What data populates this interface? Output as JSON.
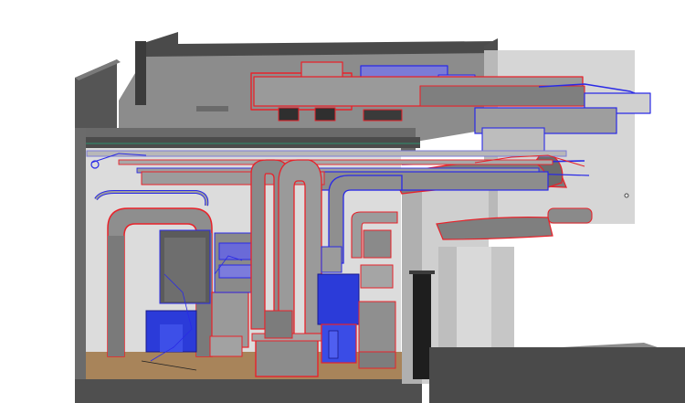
{
  "scene": {
    "subject": "building-section-mep-model",
    "colors": {
      "background": "#ffffff",
      "structure_light": "#d4d4d4",
      "structure_mid": "#a9a9a9",
      "structure_dark": "#5f5f5f",
      "structure_darker": "#3f3f3f",
      "duct_fill": "#8e8e8e",
      "duct_light": "#b5b5b5",
      "duct_edge_red": "#e8222a",
      "pipe_edge_blue": "#2a2ae6",
      "equipment_blue": "#2b3bd9",
      "floor_wood": "#a8845a",
      "door_dark": "#1e1e1e"
    },
    "icons": [
      "supply-duct-icon",
      "return-duct-icon",
      "piping-icon",
      "air-handler-icon"
    ]
  }
}
